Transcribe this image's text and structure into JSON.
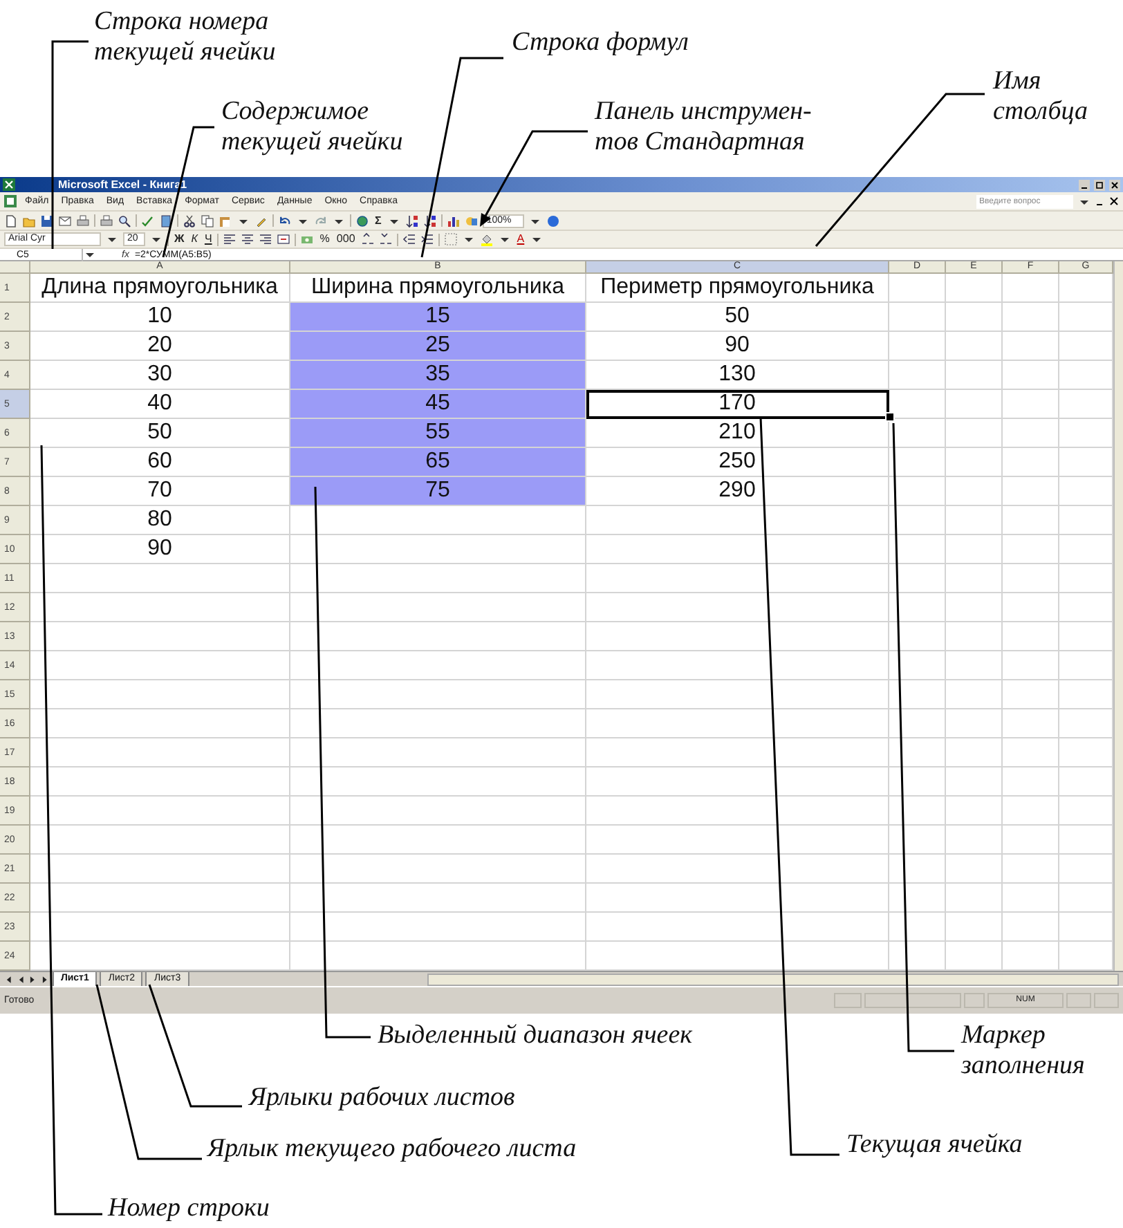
{
  "window": {
    "title": "Microsoft Excel - Книга1"
  },
  "menu": [
    "Файл",
    "Правка",
    "Вид",
    "Вставка",
    "Формат",
    "Сервис",
    "Данные",
    "Окно",
    "Справка"
  ],
  "help_field": {
    "placeholder": "Введите вопрос"
  },
  "standard_toolbar": {
    "sum": "Σ",
    "zoom": "100%"
  },
  "formatting_toolbar": {
    "font": "Arial Cyr",
    "size": "20",
    "bold": "Ж",
    "italic": "К",
    "underline": "Ч",
    "percent": "%",
    "thousands": "000",
    "font_color": "A"
  },
  "formula_bar": {
    "name_box": "C5",
    "function_label": "fx",
    "formula": "=2*СУММ(A5:B5)"
  },
  "columns": [
    {
      "label": "A",
      "selected": false
    },
    {
      "label": "B",
      "selected": false
    },
    {
      "label": "C",
      "selected": true
    },
    {
      "label": "D",
      "selected": false
    },
    {
      "label": "E",
      "selected": false
    },
    {
      "label": "F",
      "selected": false
    },
    {
      "label": "G",
      "selected": false
    }
  ],
  "rows": [
    {
      "number": "1",
      "selected": false,
      "cells": [
        {
          "text": "Длина прямоугольника",
          "selected": false,
          "active": false
        },
        {
          "text": "Ширина прямоугольника",
          "selected": false,
          "active": false
        },
        {
          "text": "Периметр прямоугольника",
          "selected": false,
          "active": false
        }
      ]
    },
    {
      "number": "2",
      "selected": false,
      "cells": [
        {
          "text": "10",
          "selected": false,
          "active": false
        },
        {
          "text": "15",
          "selected": true,
          "active": false
        },
        {
          "text": "50",
          "selected": false,
          "active": false
        }
      ]
    },
    {
      "number": "3",
      "selected": false,
      "cells": [
        {
          "text": "20",
          "selected": false,
          "active": false
        },
        {
          "text": "25",
          "selected": true,
          "active": false
        },
        {
          "text": "90",
          "selected": false,
          "active": false
        }
      ]
    },
    {
      "number": "4",
      "selected": false,
      "cells": [
        {
          "text": "30",
          "selected": false,
          "active": false
        },
        {
          "text": "35",
          "selected": true,
          "active": false
        },
        {
          "text": "130",
          "selected": false,
          "active": false
        }
      ]
    },
    {
      "number": "5",
      "selected": true,
      "cells": [
        {
          "text": "40",
          "selected": false,
          "active": false
        },
        {
          "text": "45",
          "selected": true,
          "active": false
        },
        {
          "text": "170",
          "selected": false,
          "active": true
        }
      ]
    },
    {
      "number": "6",
      "selected": false,
      "cells": [
        {
          "text": "50",
          "selected": false,
          "active": false
        },
        {
          "text": "55",
          "selected": true,
          "active": false
        },
        {
          "text": "210",
          "selected": false,
          "active": false
        }
      ]
    },
    {
      "number": "7",
      "selected": false,
      "cells": [
        {
          "text": "60",
          "selected": false,
          "active": false
        },
        {
          "text": "65",
          "selected": true,
          "active": false
        },
        {
          "text": "250",
          "selected": false,
          "active": false
        }
      ]
    },
    {
      "number": "8",
      "selected": false,
      "cells": [
        {
          "text": "70",
          "selected": false,
          "active": false
        },
        {
          "text": "75",
          "selected": true,
          "active": false
        },
        {
          "text": "290",
          "selected": false,
          "active": false
        }
      ]
    },
    {
      "number": "9",
      "selected": false,
      "cells": [
        {
          "text": "80",
          "selected": false,
          "active": false
        }
      ]
    },
    {
      "number": "10",
      "selected": false,
      "cells": [
        {
          "text": "90",
          "selected": false,
          "active": false
        }
      ]
    },
    {
      "number": "11",
      "selected": false
    },
    {
      "number": "12",
      "selected": false
    },
    {
      "number": "13",
      "selected": false
    },
    {
      "number": "14",
      "selected": false
    },
    {
      "number": "15",
      "selected": false
    },
    {
      "number": "16",
      "selected": false
    },
    {
      "number": "17",
      "selected": false
    },
    {
      "number": "18",
      "selected": false
    },
    {
      "number": "19",
      "selected": false
    },
    {
      "number": "20",
      "selected": false
    },
    {
      "number": "21",
      "selected": false
    },
    {
      "number": "22",
      "selected": false
    },
    {
      "number": "23",
      "selected": false
    },
    {
      "number": "24",
      "selected": false
    }
  ],
  "sheet_tabs": [
    {
      "label": "Лист1",
      "selected": true
    },
    {
      "label": "Лист2",
      "selected": false
    },
    {
      "label": "Лист3",
      "selected": false
    }
  ],
  "status_bar": {
    "text": "Готово",
    "num": "NUM"
  },
  "annotations": [
    {
      "lines": [
        "Строка номера",
        "текущей ячейки"
      ]
    },
    {
      "lines": [
        "Строка формул"
      ]
    },
    {
      "lines": [
        "Содержимое",
        "текущей ячейки"
      ]
    },
    {
      "lines": [
        "Панель инструмен-",
        "тов Стандартная"
      ]
    },
    {
      "lines": [
        "Имя",
        "столбца"
      ]
    },
    {
      "lines": [
        "Выделенный диапазон ячеек"
      ]
    },
    {
      "lines": [
        "Маркер",
        "заполнения"
      ]
    },
    {
      "lines": [
        "Ярлыки рабочих листов"
      ]
    },
    {
      "lines": [
        "Ярлык текущего рабочего листа"
      ]
    },
    {
      "lines": [
        "Текущая ячейка"
      ]
    },
    {
      "lines": [
        "Номер строки"
      ]
    }
  ]
}
